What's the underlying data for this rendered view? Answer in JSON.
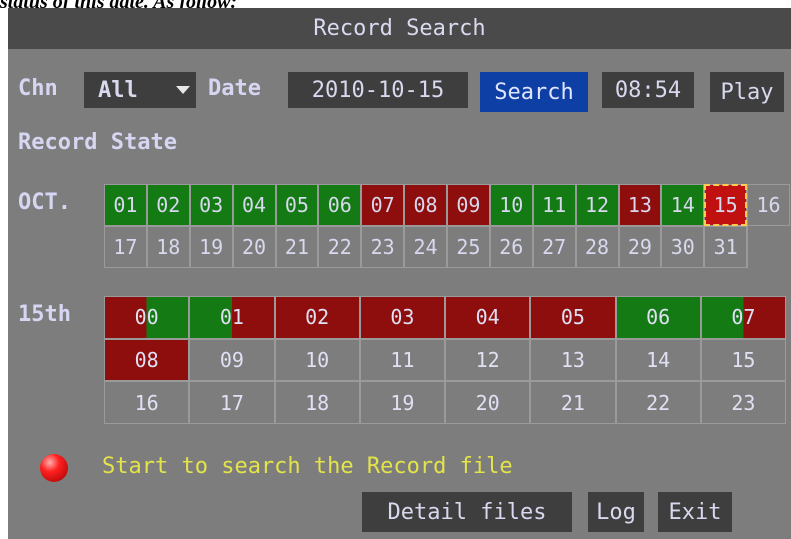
{
  "caption": "status of this date. As follow:",
  "window": {
    "title": "Record Search"
  },
  "toolbar": {
    "chn_label": "Chn",
    "chn_value": "All",
    "date_label": "Date",
    "date_value": "2010-10-15",
    "search_label": "Search",
    "time_value": "08:54",
    "play_label": "Play"
  },
  "record_state_label": "Record State",
  "month": {
    "label": "OCT.",
    "days": [
      {
        "d": "01",
        "s": "g"
      },
      {
        "d": "02",
        "s": "g"
      },
      {
        "d": "03",
        "s": "g"
      },
      {
        "d": "04",
        "s": "g"
      },
      {
        "d": "05",
        "s": "g"
      },
      {
        "d": "06",
        "s": "g"
      },
      {
        "d": "07",
        "s": "r"
      },
      {
        "d": "08",
        "s": "r"
      },
      {
        "d": "09",
        "s": "r"
      },
      {
        "d": "10",
        "s": "g"
      },
      {
        "d": "11",
        "s": "g"
      },
      {
        "d": "12",
        "s": "g"
      },
      {
        "d": "13",
        "s": "r"
      },
      {
        "d": "14",
        "s": "g"
      },
      {
        "d": "15",
        "s": "sel"
      },
      {
        "d": "16",
        "s": ""
      },
      {
        "d": "17",
        "s": ""
      },
      {
        "d": "18",
        "s": ""
      },
      {
        "d": "19",
        "s": ""
      },
      {
        "d": "20",
        "s": ""
      },
      {
        "d": "21",
        "s": ""
      },
      {
        "d": "22",
        "s": ""
      },
      {
        "d": "23",
        "s": ""
      },
      {
        "d": "24",
        "s": ""
      },
      {
        "d": "25",
        "s": ""
      },
      {
        "d": "26",
        "s": ""
      },
      {
        "d": "27",
        "s": ""
      },
      {
        "d": "28",
        "s": ""
      },
      {
        "d": "29",
        "s": ""
      },
      {
        "d": "30",
        "s": ""
      },
      {
        "d": "31",
        "s": ""
      },
      {
        "d": "",
        "s": ""
      }
    ]
  },
  "day": {
    "label": "15th",
    "hours": [
      {
        "h": "00",
        "segs": [
          [
            "#8e0d0d",
            0.5
          ],
          [
            "#137a14",
            0.5
          ]
        ]
      },
      {
        "h": "01",
        "segs": [
          [
            "#137a14",
            0.5
          ],
          [
            "#8e0d0d",
            0.5
          ]
        ]
      },
      {
        "h": "02",
        "segs": [
          [
            "#8e0d0d",
            1
          ]
        ]
      },
      {
        "h": "03",
        "segs": [
          [
            "#8e0d0d",
            1
          ]
        ]
      },
      {
        "h": "04",
        "segs": [
          [
            "#8e0d0d",
            1
          ]
        ]
      },
      {
        "h": "05",
        "segs": [
          [
            "#8e0d0d",
            1
          ]
        ]
      },
      {
        "h": "06",
        "segs": [
          [
            "#137a14",
            1
          ]
        ]
      },
      {
        "h": "07",
        "segs": [
          [
            "#137a14",
            0.5
          ],
          [
            "#8e0d0d",
            0.5
          ]
        ]
      },
      {
        "h": "08",
        "segs": [
          [
            "#8e0d0d",
            1
          ]
        ]
      },
      {
        "h": "09",
        "segs": []
      },
      {
        "h": "10",
        "segs": []
      },
      {
        "h": "11",
        "segs": []
      },
      {
        "h": "12",
        "segs": []
      },
      {
        "h": "13",
        "segs": []
      },
      {
        "h": "14",
        "segs": []
      },
      {
        "h": "15",
        "segs": []
      },
      {
        "h": "16",
        "segs": []
      },
      {
        "h": "17",
        "segs": []
      },
      {
        "h": "18",
        "segs": []
      },
      {
        "h": "19",
        "segs": []
      },
      {
        "h": "20",
        "segs": []
      },
      {
        "h": "21",
        "segs": []
      },
      {
        "h": "22",
        "segs": []
      },
      {
        "h": "23",
        "segs": []
      }
    ]
  },
  "status_text": "Start to search the Record file",
  "footer": {
    "detail_label": "Detail files",
    "log_label": "Log",
    "exit_label": "Exit"
  }
}
